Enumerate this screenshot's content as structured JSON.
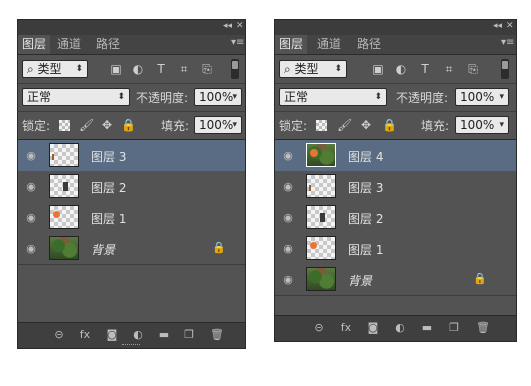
{
  "panels": [
    {
      "title_controls": {
        "collapse": "◂◂",
        "close": "✕"
      },
      "tabs": [
        "图层",
        "通道",
        "路径"
      ],
      "active_tab": 0,
      "filter": {
        "kind_label": "类型",
        "search_icon": "search-icon"
      },
      "blend_mode": "正常",
      "opacity_label": "不透明度:",
      "opacity_value": "100%",
      "lock_label": "锁定:",
      "fill_label": "填充:",
      "fill_value": "100%",
      "layers": [
        {
          "name": "图层 3",
          "selected": true,
          "thumb": "transparent"
        },
        {
          "name": "图层 2",
          "selected": false,
          "thumb": "transparent"
        },
        {
          "name": "图层 1",
          "selected": false,
          "thumb": "transparent"
        },
        {
          "name": "背景",
          "selected": false,
          "thumb": "photo",
          "locked": true
        }
      ]
    },
    {
      "title_controls": {
        "collapse": "◂◂",
        "close": "✕"
      },
      "tabs": [
        "图层",
        "通道",
        "路径"
      ],
      "active_tab": 0,
      "filter": {
        "kind_label": "类型",
        "search_icon": "search-icon"
      },
      "blend_mode": "正常",
      "opacity_label": "不透明度:",
      "opacity_value": "100%",
      "lock_label": "锁定:",
      "fill_label": "填充:",
      "fill_value": "100%",
      "layers": [
        {
          "name": "图层 4",
          "selected": true,
          "thumb": "photo"
        },
        {
          "name": "图层 3",
          "selected": false,
          "thumb": "transparent"
        },
        {
          "name": "图层 2",
          "selected": false,
          "thumb": "transparent"
        },
        {
          "name": "图层 1",
          "selected": false,
          "thumb": "transparent"
        },
        {
          "name": "背景",
          "selected": false,
          "thumb": "photo",
          "locked": true
        }
      ]
    }
  ],
  "colors": {
    "panel_bg": "#535353",
    "selected_layer": "#596c83",
    "bottom_bar": "#3f3f3f"
  }
}
